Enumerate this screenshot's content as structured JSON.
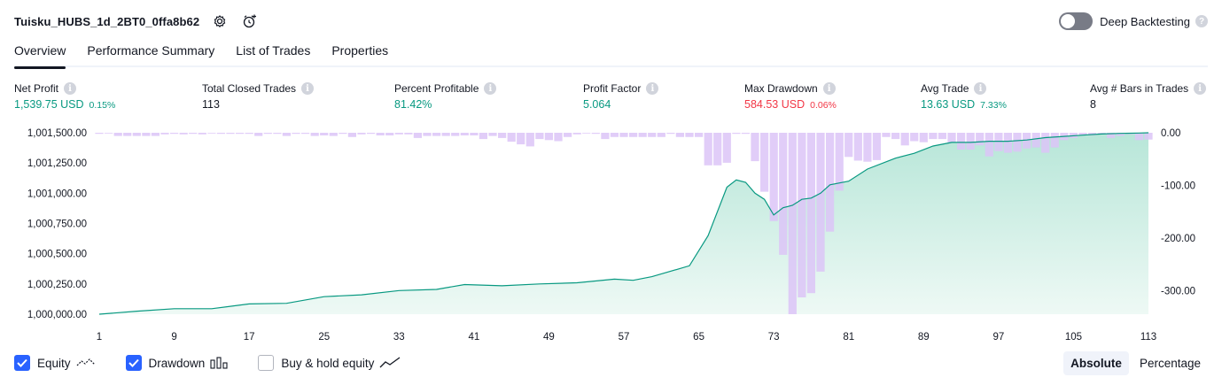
{
  "header": {
    "title": "Tuisku_HUBS_1d_2BT0_0ffa8b62",
    "deep_backtesting_label": "Deep Backtesting",
    "deep_backtesting_on": false
  },
  "tabs": [
    {
      "label": "Overview",
      "active": true
    },
    {
      "label": "Performance Summary",
      "active": false
    },
    {
      "label": "List of Trades",
      "active": false
    },
    {
      "label": "Properties",
      "active": false
    }
  ],
  "metrics": {
    "net_profit": {
      "label": "Net Profit",
      "value": "1,539.75 USD",
      "pct": "0.15%"
    },
    "total_closed_trades": {
      "label": "Total Closed Trades",
      "value": "113"
    },
    "percent_profitable": {
      "label": "Percent Profitable",
      "value": "81.42%"
    },
    "profit_factor": {
      "label": "Profit Factor",
      "value": "5.064"
    },
    "max_drawdown": {
      "label": "Max Drawdown",
      "value": "584.53 USD",
      "pct": "0.06%"
    },
    "avg_trade": {
      "label": "Avg Trade",
      "value": "13.63 USD",
      "pct": "7.33%"
    },
    "avg_bars": {
      "label": "Avg # Bars in Trades",
      "value": "8"
    }
  },
  "legend": {
    "equity": {
      "label": "Equity",
      "checked": true
    },
    "drawdown": {
      "label": "Drawdown",
      "checked": true
    },
    "buy_hold": {
      "label": "Buy & hold equity",
      "checked": false
    }
  },
  "mode": {
    "absolute": "Absolute",
    "percentage": "Percentage",
    "active": "absolute"
  },
  "colors": {
    "accent": "#2962ff",
    "equity_line": "#089981",
    "equity_fill": "#cdeee4",
    "drawdown_bar": "#dcc4f7",
    "positive": "#089981",
    "negative": "#f23645"
  },
  "chart_data": {
    "type": "area",
    "x_ticks": [
      "1",
      "9",
      "17",
      "25",
      "33",
      "41",
      "49",
      "57",
      "65",
      "73",
      "81",
      "89",
      "97",
      "105",
      "113"
    ],
    "left_ticks": [
      "1,001,500.00",
      "1,001,250.00",
      "1,001,000.00",
      "1,000,750.00",
      "1,000,500.00",
      "1,000,250.00",
      "1,000,000.00"
    ],
    "right_ticks": [
      "0.00",
      "-100.00",
      "-200.00",
      "-300.00"
    ],
    "equity_ylim": [
      1000000,
      1001500
    ],
    "drawdown_ylim": [
      -345,
      0
    ],
    "series": [
      {
        "name": "Equity",
        "x": [
          1,
          5,
          9,
          13,
          17,
          21,
          25,
          29,
          33,
          37,
          40,
          44,
          48,
          52,
          56,
          58,
          60,
          64,
          66,
          68,
          69,
          70,
          71,
          72,
          73,
          74,
          75,
          76,
          77,
          78,
          79,
          81,
          83,
          86,
          88,
          90,
          92,
          94,
          96,
          98,
          100,
          102,
          104,
          106,
          108,
          110,
          112,
          113
        ],
        "values": [
          1000000,
          1000025,
          1000045,
          1000045,
          1000085,
          1000090,
          1000145,
          1000160,
          1000195,
          1000205,
          1000245,
          1000235,
          1000250,
          1000260,
          1000290,
          1000280,
          1000310,
          1000400,
          1000650,
          1001050,
          1001110,
          1001090,
          1001000,
          1000950,
          1000820,
          1000880,
          1000900,
          1000950,
          1000960,
          1001000,
          1001070,
          1001100,
          1001200,
          1001290,
          1001330,
          1001390,
          1001420,
          1001420,
          1001430,
          1001430,
          1001440,
          1001460,
          1001470,
          1001480,
          1001490,
          1001495,
          1001498,
          1001500
        ]
      },
      {
        "name": "Drawdown",
        "values": [
          -2,
          -1,
          -6,
          -6,
          -6,
          -6,
          -6,
          -3,
          -2,
          -3,
          -2,
          -3,
          -1,
          -2,
          -2,
          -2,
          -2,
          -6,
          -2,
          -2,
          -6,
          -2,
          -2,
          -6,
          -5,
          -6,
          -2,
          -8,
          -3,
          -2,
          -5,
          -5,
          -3,
          -3,
          -10,
          -6,
          -6,
          -6,
          -6,
          -5,
          -5,
          -12,
          -6,
          -10,
          -17,
          -22,
          -26,
          -12,
          -14,
          -16,
          -8,
          -3,
          -1,
          -2,
          -12,
          -8,
          -8,
          -8,
          -8,
          -8,
          -8,
          -2,
          -8,
          -8,
          -8,
          -62,
          -62,
          -57,
          -2,
          -2,
          -54,
          -112,
          -168,
          -232,
          -345,
          -313,
          -305,
          -264,
          -188,
          -110,
          -46,
          -53,
          -55,
          -52,
          -8,
          -12,
          -24,
          -16,
          -18,
          -12,
          -12,
          -19,
          -32,
          -32,
          -24,
          -45,
          -35,
          -38,
          -36,
          -30,
          -28,
          -38,
          -28,
          -14,
          -10,
          -5,
          -5,
          -3,
          -10,
          -6,
          -3,
          -14,
          -13
        ]
      }
    ],
    "grid": false
  }
}
